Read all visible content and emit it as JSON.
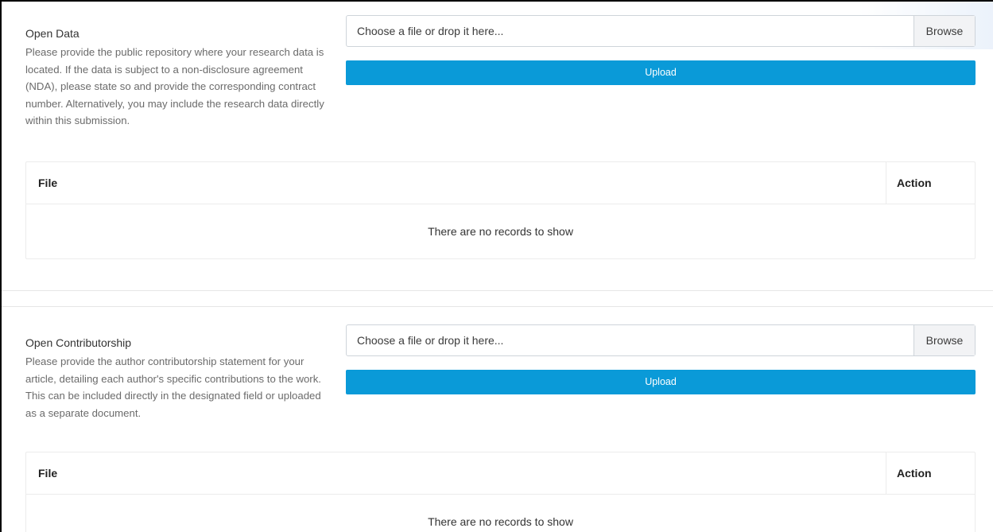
{
  "sections": [
    {
      "title": "Open Data",
      "description": "Please provide the public repository where your research data is located. If the data is subject to a non-disclosure agreement (NDA), please state so and provide the corresponding contract number. Alternatively, you may include the research data directly within this submission.",
      "file_placeholder": "Choose a file or drop it here...",
      "browse_label": "Browse",
      "upload_label": "Upload",
      "table": {
        "columns": [
          "File",
          "Action"
        ],
        "empty_text": "There are no records to show"
      }
    },
    {
      "title": "Open Contributorship",
      "description": "Please provide the author contributorship statement for your article, detailing each author's specific contributions to the work. This can be included directly in the designated field or uploaded as a separate document.",
      "file_placeholder": "Choose a file or drop it here...",
      "browse_label": "Browse",
      "upload_label": "Upload",
      "table": {
        "columns": [
          "File",
          "Action"
        ],
        "empty_text": "There are no records to show"
      }
    }
  ],
  "colors": {
    "upload_button": "#0a9ad8",
    "border": "#ced4da",
    "frame": "#000000"
  }
}
